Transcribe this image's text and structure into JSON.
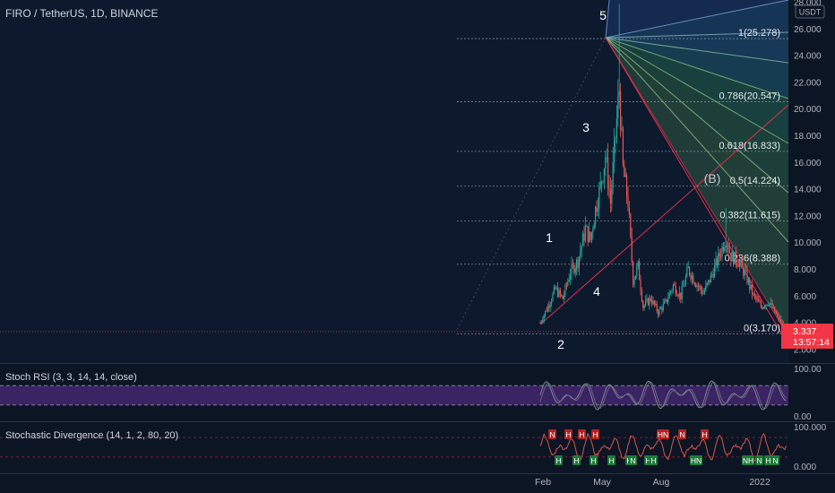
{
  "title": "FIRO / TetherUS, 1D, BINANCE",
  "currency": "USDT",
  "price_tag": {
    "price": "3.337",
    "countdown": "13:57:14",
    "value": 3.337
  },
  "colors": {
    "background": "#0c1524",
    "candle_up": "#26a69a",
    "candle_down": "#ef5350",
    "fan_line": "#e0304a",
    "price_tag": "#f23645",
    "rsi_band": "#4a2a7a",
    "grid_text": "#b2b5be"
  },
  "chart_data": {
    "type": "candlestick",
    "x_ticks": [
      "Feb",
      "May",
      "Aug",
      "2022"
    ],
    "y_ticks": [
      "2.000",
      "4.000",
      "6.000",
      "8.000",
      "10.000",
      "12.000",
      "14.000",
      "16.000",
      "18.000",
      "20.000",
      "22.000",
      "24.000",
      "26.000",
      "28.000"
    ],
    "ylim": [
      2,
      28
    ],
    "wave_labels": [
      "1",
      "2",
      "3",
      "4",
      "5",
      "(B)"
    ],
    "fib_levels": [
      {
        "label": "1(25.278)",
        "value": 25.278
      },
      {
        "label": "0.786(20.547)",
        "value": 20.547
      },
      {
        "label": "0.618(16.833)",
        "value": 16.833
      },
      {
        "label": "0.5(14.224)",
        "value": 14.224
      },
      {
        "label": "0.382(11.615)",
        "value": 11.615
      },
      {
        "label": "0.236(8.388)",
        "value": 8.388
      },
      {
        "label": "0(3.170)",
        "value": 3.17
      }
    ],
    "price_path": [
      {
        "i": 0,
        "v": 4.0
      },
      {
        "i": 6,
        "v": 5.2
      },
      {
        "i": 12,
        "v": 6.5
      },
      {
        "i": 18,
        "v": 5.8
      },
      {
        "i": 24,
        "v": 7.8
      },
      {
        "i": 30,
        "v": 8.6
      },
      {
        "i": 36,
        "v": 11.0
      },
      {
        "i": 40,
        "v": 10.2
      },
      {
        "i": 44,
        "v": 12.5
      },
      {
        "i": 48,
        "v": 14.2
      },
      {
        "i": 52,
        "v": 16.5
      },
      {
        "i": 56,
        "v": 13.0
      },
      {
        "i": 60,
        "v": 18.0
      },
      {
        "i": 63,
        "v": 21.5
      },
      {
        "i": 66,
        "v": 15.5
      },
      {
        "i": 70,
        "v": 13.0
      },
      {
        "i": 74,
        "v": 7.2
      },
      {
        "i": 78,
        "v": 8.2
      },
      {
        "i": 82,
        "v": 5.2
      },
      {
        "i": 88,
        "v": 5.8
      },
      {
        "i": 94,
        "v": 4.8
      },
      {
        "i": 100,
        "v": 5.5
      },
      {
        "i": 106,
        "v": 6.8
      },
      {
        "i": 112,
        "v": 6.0
      },
      {
        "i": 118,
        "v": 8.0
      },
      {
        "i": 124,
        "v": 7.0
      },
      {
        "i": 130,
        "v": 6.2
      },
      {
        "i": 136,
        "v": 7.4
      },
      {
        "i": 142,
        "v": 8.8
      },
      {
        "i": 148,
        "v": 10.4
      },
      {
        "i": 152,
        "v": 9.0
      },
      {
        "i": 158,
        "v": 8.6
      },
      {
        "i": 164,
        "v": 7.5
      },
      {
        "i": 170,
        "v": 6.0
      },
      {
        "i": 176,
        "v": 5.2
      },
      {
        "i": 182,
        "v": 5.6
      },
      {
        "i": 188,
        "v": 4.6
      },
      {
        "i": 192,
        "v": 4.0
      },
      {
        "i": 196,
        "v": 3.337
      }
    ],
    "indicators": [
      {
        "name": "Stoch RSI (3, 3, 14, 14, close)",
        "ylim": [
          0,
          100
        ],
        "y_ticks": [
          "100.00",
          "0.00"
        ],
        "band": [
          20,
          80
        ]
      },
      {
        "name": "Stochastic Divergence (14, 1, 2, 80, 20)",
        "ylim": [
          0,
          100
        ],
        "y_ticks": [
          "100.000",
          "0.000"
        ],
        "levels": [
          80,
          20
        ],
        "markers_top": [
          "N",
          "H",
          "H",
          "H",
          "HN",
          "N",
          "H"
        ],
        "markers_bottom": [
          "H",
          "H",
          "H",
          "H",
          "H",
          "N",
          "H",
          "H",
          "HN",
          "NH",
          "N",
          "H",
          "N"
        ]
      }
    ]
  }
}
